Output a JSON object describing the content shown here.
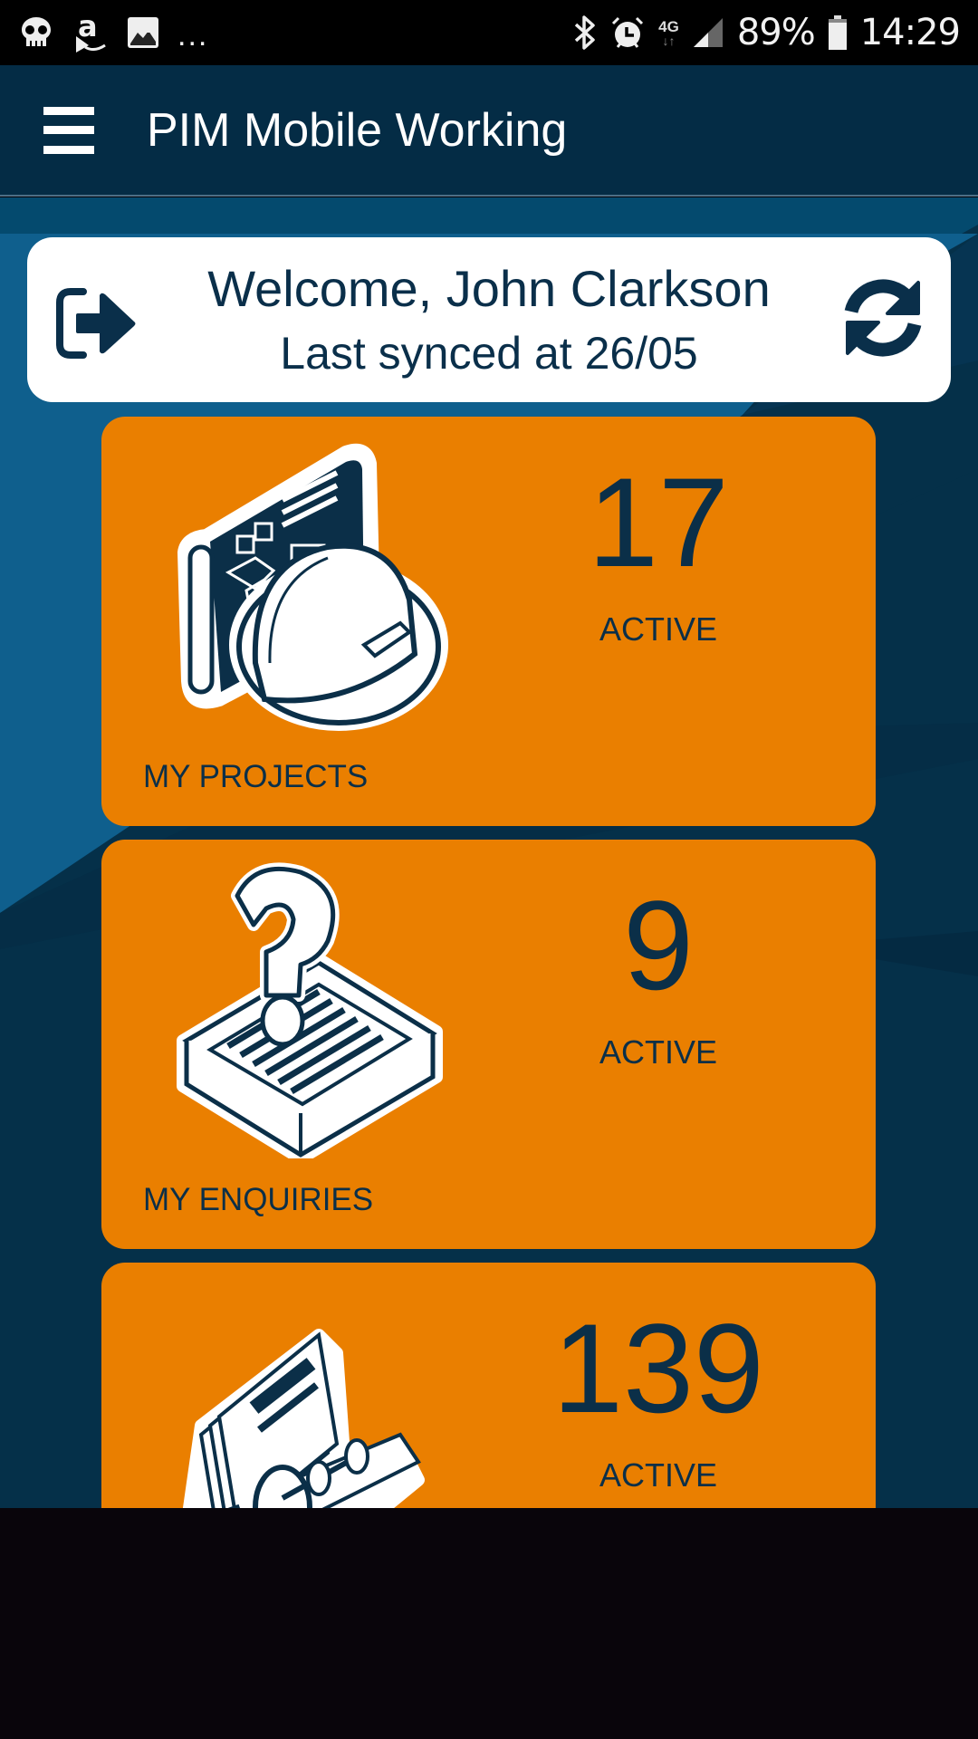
{
  "status_bar": {
    "left_icons": [
      "ghost-notification-icon",
      "amazon-icon",
      "gallery-icon"
    ],
    "overflow": "...",
    "right_icons": [
      "bluetooth-icon",
      "alarm-icon",
      "network-4g-icon",
      "signal-icon",
      "battery-icon"
    ],
    "network_type": "4G",
    "battery": "89%",
    "time": "14:29"
  },
  "app_bar": {
    "menu_icon": "hamburger-menu-icon",
    "title": "PIM Mobile Working"
  },
  "welcome": {
    "greeting": "Welcome, John Clarkson",
    "last_synced": "Last synced at 26/05",
    "logout_icon": "logout-icon",
    "sync_icon": "sync-icon"
  },
  "tiles": [
    {
      "label": "MY PROJECTS",
      "count": "17",
      "status": "ACTIVE",
      "icon": "hard-hat-blueprint-icon"
    },
    {
      "label": "MY ENQUIRIES",
      "count": "9",
      "status": "ACTIVE",
      "icon": "question-inbox-icon"
    },
    {
      "label": "",
      "count": "139",
      "status": "ACTIVE",
      "icon": "rolodex-icon"
    }
  ],
  "colors": {
    "app_bar": "#042c45",
    "background": "#053049",
    "tile": "#ea7f00",
    "text_dark": "#0b2f48",
    "card": "#ffffff"
  }
}
